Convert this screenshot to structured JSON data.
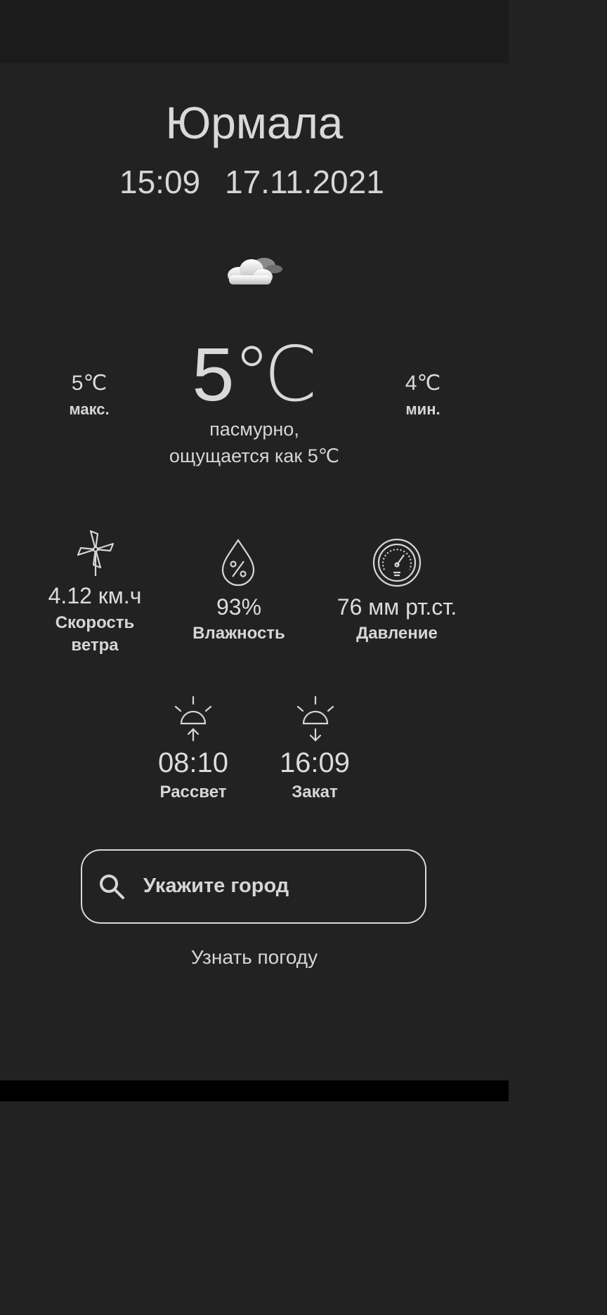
{
  "header": {
    "city": "Юрмала",
    "time": "15:09",
    "date": "17.11.2021"
  },
  "current": {
    "icon": "cloudy-icon",
    "temperature": "5℃",
    "max_value": "5℃",
    "max_label": "макс.",
    "min_value": "4℃",
    "min_label": "мин.",
    "description_line1": "пасмурно,",
    "description_line2": "ощущается как 5℃"
  },
  "stats": {
    "wind": {
      "icon": "windmill-icon",
      "value": "4.12 км.ч",
      "label_line1": "Скорость",
      "label_line2": "ветра"
    },
    "humidity": {
      "icon": "humidity-drop-icon",
      "value": "93%",
      "label": "Влажность"
    },
    "pressure": {
      "icon": "barometer-icon",
      "value": "76 мм рт.ст.",
      "label": "Давление"
    }
  },
  "sun": {
    "sunrise": {
      "icon": "sunrise-icon",
      "value": "08:10",
      "label": "Рассвет"
    },
    "sunset": {
      "icon": "sunset-icon",
      "value": "16:09",
      "label": "Закат"
    }
  },
  "search": {
    "placeholder": "Укажите город",
    "value": "",
    "button_label": "Узнать погоду"
  },
  "colors": {
    "background": "#222222",
    "status_bar": "#1b1b1b",
    "text": "#d6d6d6"
  }
}
